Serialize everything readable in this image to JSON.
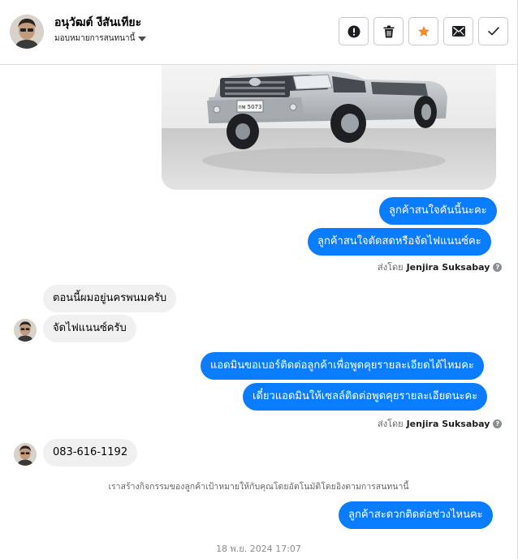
{
  "header": {
    "contact_name": "อนุวัฒต์ งีสันเทียะ",
    "assign_label": "มอบหมายการสนทนานี้",
    "toolbar": {
      "mark_spam_icon": "alert-circle-icon",
      "delete_icon": "trash-icon",
      "star_icon": "star-icon",
      "unread_icon": "envelope-icon",
      "done_icon": "check-icon"
    }
  },
  "colors": {
    "outgoing_bubble": "#0a7cff",
    "incoming_bubble": "#f0f0f0",
    "star": "#f28b2a"
  },
  "messages": {
    "out1": "ลูกค้าสนใจคันนี้นะคะ",
    "out2": "ลูกค้าสนใจตัดสดหรือจัดไฟแนนซ์คะ",
    "sent_by_1_prefix": "ส่งโดย",
    "sent_by_1_name": "Jenjira Suksabay",
    "in1": "ตอนนี้ผมอยู่นครพนมครับ",
    "in2": "จัดไฟแนนซ์ครับ",
    "out3": "แอดมินขอเบอร์ติดต่อลูกค้าเพื่อพูดคุยรายละเอียดได้ไหมคะ",
    "out4": "เดี๋ยวแอดมินให้เซลล์ติดต่อพูดคุยรายละเอียดนะคะ",
    "sent_by_2_prefix": "ส่งโดย",
    "sent_by_2_name": "Jenjira Suksabay",
    "in3": "083-616-1192",
    "system_note": "เราสร้างกิจกรรมของลูกค้าเป้าหมายให้กับคุณโดยอัตโนมัติโดยอิงตามการสนทนานี้",
    "out5": "ลูกค้าสะดวกติดต่อช่วงไหนคะ",
    "timestamp": "18 พ.ย. 2024 17:07"
  },
  "image": {
    "plate_text": "กพ 5073"
  }
}
